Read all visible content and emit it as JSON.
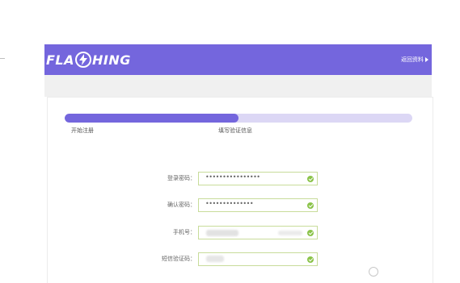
{
  "header": {
    "logo_left": "FLA",
    "logo_right": "HING",
    "logo_mark": "lightning-bolt-icon",
    "back_link": "返回资料"
  },
  "progress": {
    "completed_fraction": 0.5,
    "steps": [
      {
        "label": "开始注册"
      },
      {
        "label": "填写验证信息"
      }
    ]
  },
  "form": {
    "fields": [
      {
        "label": "登录密码：",
        "value": "••••••••••••••••",
        "status": "valid"
      },
      {
        "label": "确认密码：",
        "value": "••••••••••••••",
        "status": "valid"
      },
      {
        "label": "手机号：",
        "value": "",
        "status": "valid"
      },
      {
        "label": "短信验证码：",
        "value": "",
        "status": "valid"
      }
    ]
  },
  "colors": {
    "brand": "#7466dd",
    "progress_track": "#dcd7f5",
    "valid": "#8bc34a",
    "field_border": "#c8dc9a"
  }
}
